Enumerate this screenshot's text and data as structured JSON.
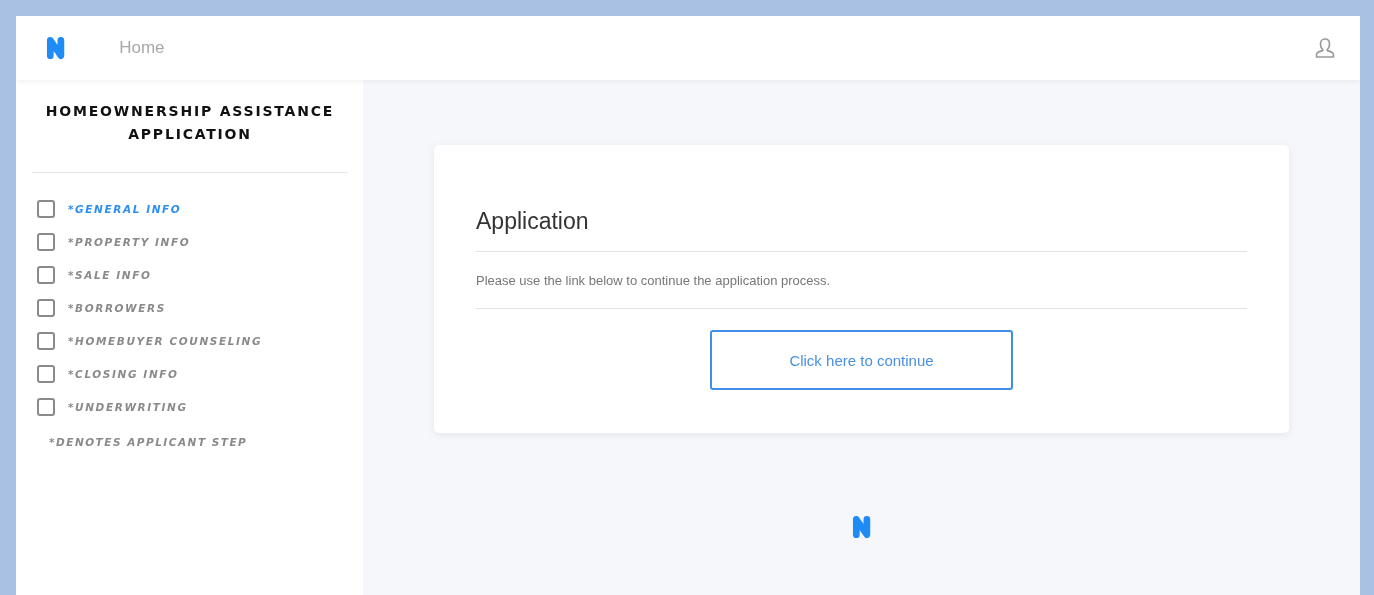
{
  "header": {
    "nav_link": "Home"
  },
  "sidebar": {
    "title": "HOMEOWNERSHIP ASSISTANCE APPLICATION",
    "steps": [
      {
        "label": "*GENERAL INFO",
        "checked": false,
        "selected": true
      },
      {
        "label": "*PROPERTY INFO",
        "checked": false,
        "selected": false
      },
      {
        "label": "*SALE INFO",
        "checked": false,
        "selected": false
      },
      {
        "label": "*BORROWERS",
        "checked": false,
        "selected": false
      },
      {
        "label": "*HOMEBUYER COUNSELING",
        "checked": false,
        "selected": false
      },
      {
        "label": "*CLOSING INFO",
        "checked": false,
        "selected": false
      },
      {
        "label": "*UNDERWRITING",
        "checked": false,
        "selected": false
      }
    ],
    "note": "*DENOTES APPLICANT STEP"
  },
  "card": {
    "title": "Application",
    "message": "Please use the link below to continue the application process.",
    "button": "Click here to continue"
  }
}
